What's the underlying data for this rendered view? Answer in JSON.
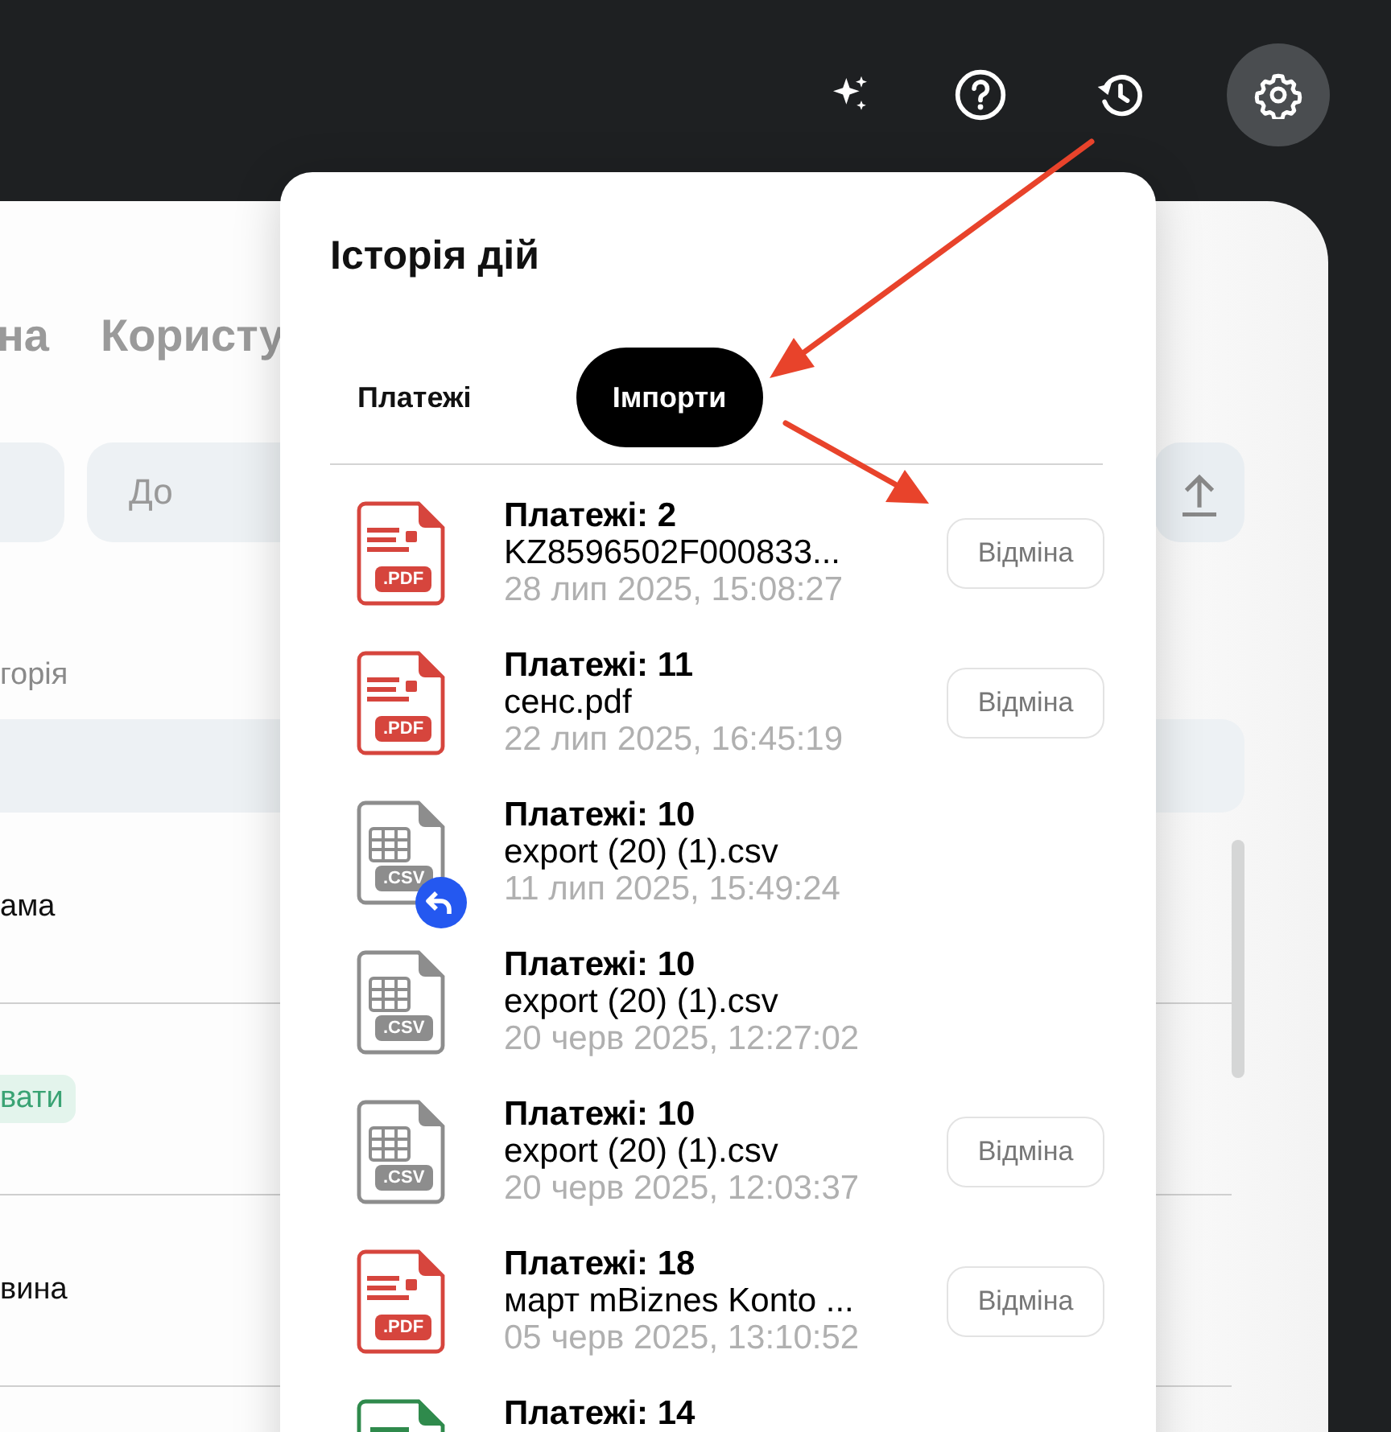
{
  "background": {
    "tabs": [
      {
        "label": "на"
      },
      {
        "label": "Користу"
      }
    ],
    "date_to_placeholder": "До",
    "column_label": "горія",
    "rows": [
      {
        "kind": "text",
        "text": "ама"
      },
      {
        "kind": "badge",
        "text": "вати"
      },
      {
        "kind": "text",
        "text": "вина"
      }
    ]
  },
  "popover": {
    "title": "Історія дій",
    "tabs": [
      {
        "label": "Платежі",
        "selected": false
      },
      {
        "label": "Імпорти",
        "selected": true
      }
    ],
    "imports": [
      {
        "kind": "pdf",
        "badge": ".PDF",
        "title": "Платежі: 2",
        "file_name": "KZ8596502F000833...",
        "date": "28 лип 2025, 15:08:27",
        "undone": false,
        "action": "Відміна"
      },
      {
        "kind": "pdf",
        "badge": ".PDF",
        "title": "Платежі: 11",
        "file_name": "сенс.pdf",
        "date": "22 лип 2025, 16:45:19",
        "undone": false,
        "action": "Відміна"
      },
      {
        "kind": "csv",
        "badge": ".CSV",
        "title": "Платежі: 10",
        "file_name": "export (20) (1).csv",
        "date": "11 лип 2025, 15:49:24",
        "undone": true
      },
      {
        "kind": "csv",
        "badge": ".CSV",
        "title": "Платежі: 10",
        "file_name": "export (20) (1).csv",
        "date": "20 черв 2025, 12:27:02",
        "undone": false
      },
      {
        "kind": "csv",
        "badge": ".CSV",
        "title": "Платежі: 10",
        "file_name": "export (20) (1).csv",
        "date": "20 черв 2025, 12:03:37",
        "undone": false,
        "action": "Відміна"
      },
      {
        "kind": "pdf",
        "badge": ".PDF",
        "title": "Платежі: 18",
        "file_name": "март mBiznes Konto ...",
        "date": "05 черв 2025, 13:10:52",
        "undone": false,
        "action": "Відміна"
      },
      {
        "kind": "xls",
        "title": "Платежі: 14"
      }
    ]
  }
}
